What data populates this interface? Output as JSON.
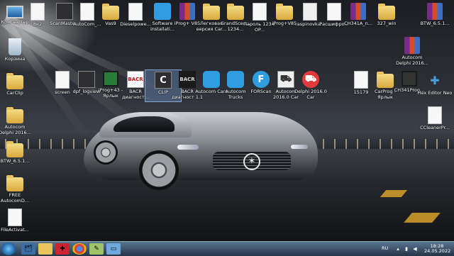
{
  "desktop": {
    "icons": [
      {
        "label": "Компьютер",
        "glyph": "computer-icon"
      },
      {
        "label": "8к2",
        "glyph": "document-icon"
      },
      {
        "label": "ScanMaste...",
        "glyph": "application-icon"
      },
      {
        "label": "AutoCom_...",
        "glyph": "document-icon"
      },
      {
        "label": "Vas9",
        "glyph": "folder-icon"
      },
      {
        "label": "Dieselpowe...",
        "glyph": "document-icon"
      },
      {
        "label": "Software installati...",
        "glyph": "installer-icon"
      },
      {
        "label": "iProg+ V85",
        "glyph": "archive-icon"
      },
      {
        "label": "Легковая версия Car...",
        "glyph": "folder-icon"
      },
      {
        "label": "GrandScen... 1234...",
        "glyph": "folder-icon"
      },
      {
        "label": "Пароль 1234. OP...",
        "glyph": "document-icon"
      },
      {
        "label": "iProg+V85",
        "glyph": "folder-icon"
      },
      {
        "label": "raspinovka...",
        "glyph": "image-icon"
      },
      {
        "label": "Расшифро...",
        "glyph": "document-icon"
      },
      {
        "label": "CH341A_n...",
        "glyph": "archive-icon"
      },
      {
        "label": "327_win",
        "glyph": "folder-icon"
      },
      {
        "label": "BTW_6.5.1...",
        "glyph": "archive-icon"
      },
      {
        "label": "Корзина",
        "glyph": "recycle-bin-icon"
      },
      {
        "label": "Autocom Delphi 2016...",
        "glyph": "archive-icon"
      },
      {
        "label": "CarClip",
        "glyph": "folder-icon"
      },
      {
        "label": "screen",
        "glyph": "document-icon"
      },
      {
        "label": "dpf_logview",
        "glyph": "application-icon"
      },
      {
        "label": "iProg+43 - Ярлык",
        "glyph": "chip-icon"
      },
      {
        "label": "BACR диагност...",
        "glyph": "bacr-icon"
      },
      {
        "label": "CLIP",
        "glyph": "clip-icon"
      },
      {
        "label": "BACR диагност 1.1",
        "glyph": "bacr-icon"
      },
      {
        "label": "Autocom Cars",
        "glyph": "autocom-icon"
      },
      {
        "label": "Autocom Trucks",
        "glyph": "autocom-icon"
      },
      {
        "label": "FORScan",
        "glyph": "forscan-icon"
      },
      {
        "label": "Autocom 2016.0 Car",
        "glyph": "car-icon"
      },
      {
        "label": "Delphi 2016.0 Car",
        "glyph": "car-icon"
      },
      {
        "label": "15179",
        "glyph": "document-icon"
      },
      {
        "label": "CarProg - Ярлык",
        "glyph": "folder-icon"
      },
      {
        "label": "CH341Prog...",
        "glyph": "chip-icon"
      },
      {
        "label": "Hex Editor Neo",
        "glyph": "hex-editor-icon"
      },
      {
        "label": "Autocom Delphi 2016...",
        "glyph": "folder-icon"
      },
      {
        "label": "CCleanerPr...",
        "glyph": "document-icon"
      },
      {
        "label": "BTW_6.5.1...",
        "glyph": "folder-icon"
      },
      {
        "label": "FREE AutocomD...",
        "glyph": "folder-icon"
      },
      {
        "label": "FileActivat...",
        "glyph": "document-icon"
      }
    ]
  },
  "taskbar": {
    "pinned": [
      "explorer-icon",
      "folder-icon",
      "app-icon",
      "chrome-icon",
      "notes-icon",
      "window-icon"
    ],
    "language": "RU",
    "time": "18:28",
    "date": "24.05.2022"
  },
  "colors": {
    "taskbar": "#2d4560",
    "folder": "#e8c35e"
  }
}
